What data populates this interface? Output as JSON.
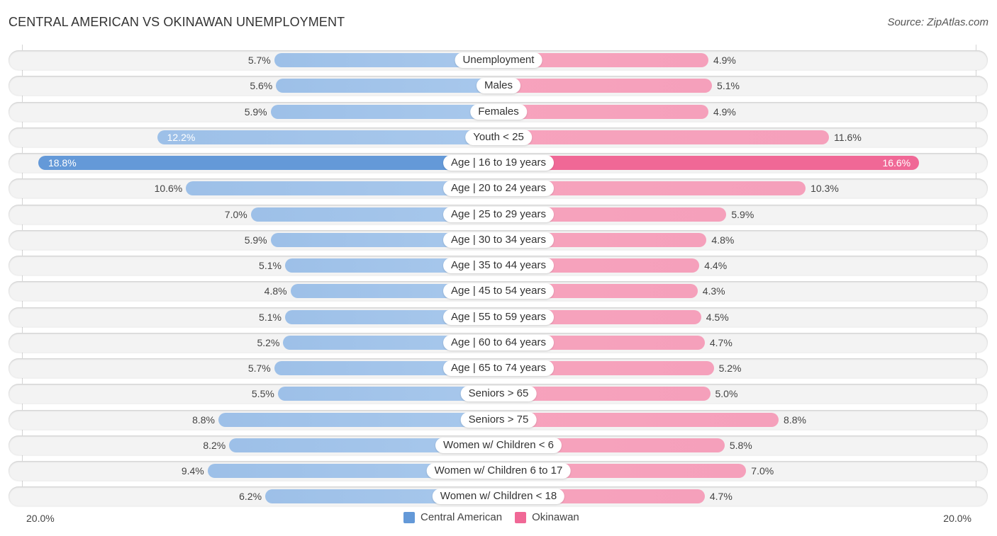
{
  "header": {
    "title": "CENTRAL AMERICAN VS OKINAWAN UNEMPLOYMENT",
    "source": "Source: ZipAtlas.com"
  },
  "colors": {
    "central_american": "#6499d8",
    "okinawan": "#f06896",
    "central_american_light": "#a5c6eb",
    "okinawan_light": "#f6a2bc"
  },
  "chart_data": {
    "type": "bar",
    "orientation": "horizontal-diverging",
    "title": "CENTRAL AMERICAN VS OKINAWAN UNEMPLOYMENT",
    "categories": [
      "Unemployment",
      "Males",
      "Females",
      "Youth < 25",
      "Age | 16 to 19 years",
      "Age | 20 to 24 years",
      "Age | 25 to 29 years",
      "Age | 30 to 34 years",
      "Age | 35 to 44 years",
      "Age | 45 to 54 years",
      "Age | 55 to 59 years",
      "Age | 60 to 64 years",
      "Age | 65 to 74 years",
      "Seniors > 65",
      "Seniors > 75",
      "Women w/ Children < 6",
      "Women w/ Children 6 to 17",
      "Women w/ Children < 18"
    ],
    "series": [
      {
        "name": "Central American",
        "side": "left",
        "values": [
          5.7,
          5.6,
          5.9,
          12.2,
          18.8,
          10.6,
          7.0,
          5.9,
          5.1,
          4.8,
          5.1,
          5.2,
          5.7,
          5.5,
          8.8,
          8.2,
          9.4,
          6.2
        ],
        "labels": [
          "5.7%",
          "5.6%",
          "5.9%",
          "12.2%",
          "18.8%",
          "10.6%",
          "7.0%",
          "5.9%",
          "5.1%",
          "4.8%",
          "5.1%",
          "5.2%",
          "5.7%",
          "5.5%",
          "8.8%",
          "8.2%",
          "9.4%",
          "6.2%"
        ]
      },
      {
        "name": "Okinawan",
        "side": "right",
        "values": [
          4.9,
          5.1,
          4.9,
          11.6,
          16.6,
          10.3,
          5.9,
          4.8,
          4.4,
          4.3,
          4.5,
          4.7,
          5.2,
          5.0,
          8.8,
          5.8,
          7.0,
          4.7
        ],
        "labels": [
          "4.9%",
          "5.1%",
          "4.9%",
          "11.6%",
          "16.6%",
          "10.3%",
          "5.9%",
          "4.8%",
          "4.4%",
          "4.3%",
          "4.5%",
          "4.7%",
          "5.2%",
          "5.0%",
          "8.8%",
          "5.8%",
          "7.0%",
          "4.7%"
        ]
      }
    ],
    "unit": "%",
    "xlim": [
      0,
      20
    ],
    "axis_labels": {
      "left": "20.0%",
      "right": "20.0%"
    },
    "legend": {
      "position": "bottom-center",
      "entries": [
        "Central American",
        "Okinawan"
      ]
    },
    "grid": false
  }
}
